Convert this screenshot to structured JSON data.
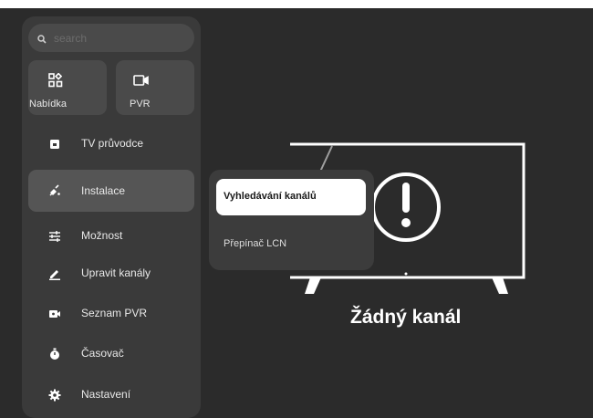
{
  "search": {
    "placeholder": "search"
  },
  "tiles": [
    {
      "label": "Nabídka",
      "icon": "apps-grid-icon"
    },
    {
      "label": "PVR",
      "icon": "video-camera-icon"
    }
  ],
  "nav": {
    "items": [
      {
        "label": "TV průvodce",
        "icon": "tv-guide-icon"
      },
      {
        "label": "Instalace",
        "icon": "satellite-icon",
        "active": true
      },
      {
        "label": "Možnost",
        "icon": "sliders-icon"
      },
      {
        "label": "Upravit kanály",
        "icon": "pencil-icon"
      },
      {
        "label": "Seznam PVR",
        "icon": "recording-icon"
      },
      {
        "label": "Časovač",
        "icon": "stopwatch-icon"
      },
      {
        "label": "Nastavení",
        "icon": "gear-icon"
      }
    ]
  },
  "submenu": {
    "items": [
      {
        "label": "Vyhledávání kanálů",
        "selected": true
      },
      {
        "label": "Přepínač LCN",
        "selected": false
      }
    ]
  },
  "main": {
    "empty_message": "Žádný kanál",
    "illustration": "tv-warning-icon"
  },
  "colors": {
    "background": "#2b2b2b",
    "sidebar": "#3a3a3a",
    "selected": "#ffffff"
  }
}
